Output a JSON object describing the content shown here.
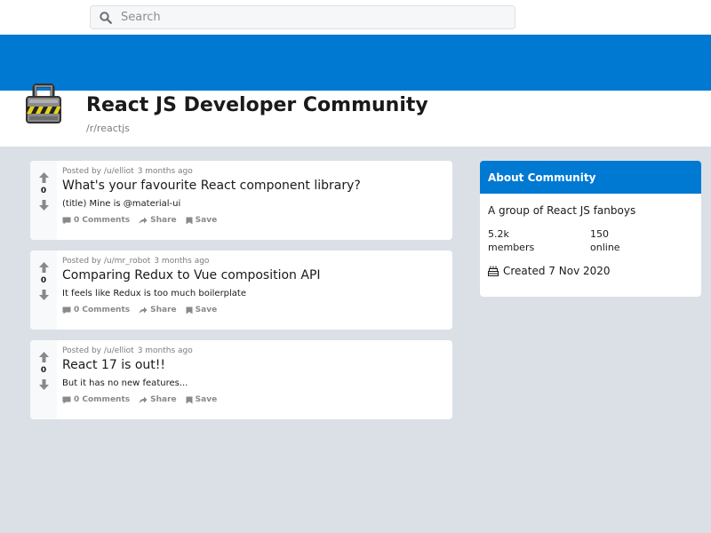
{
  "search": {
    "placeholder": "Search"
  },
  "community": {
    "title": "React JS Developer Community",
    "subreddit": "/r/reactjs",
    "icon": "padlock-icon"
  },
  "colors": {
    "banner": "#0079d3",
    "background": "#dae0e6",
    "about_header": "#0079d3"
  },
  "posts": [
    {
      "score": "0",
      "posted_by": "Posted by /u/elliot",
      "age": "3 months ago",
      "title": "What's your favourite React component library?",
      "text": "(title) Mine is @material-ui",
      "comments": "0 Comments",
      "share": "Share",
      "save": "Save"
    },
    {
      "score": "0",
      "posted_by": "Posted by /u/mr_robot",
      "age": "3 months ago",
      "title": "Comparing Redux to Vue composition API",
      "text": "It feels like Redux is too much boilerplate",
      "comments": "0 Comments",
      "share": "Share",
      "save": "Save"
    },
    {
      "score": "0",
      "posted_by": "Posted by /u/elliot",
      "age": "3 months ago",
      "title": "React 17 is out!!",
      "text": "But it has no new features...",
      "comments": "0 Comments",
      "share": "Share",
      "save": "Save"
    }
  ],
  "about": {
    "header": "About Community",
    "description": "A group of React JS fanboys",
    "members_count": "5.2k",
    "members_label": "members",
    "online_count": "150",
    "online_label": "online",
    "created": "Created 7 Nov 2020",
    "created_icon": "cake-icon"
  }
}
